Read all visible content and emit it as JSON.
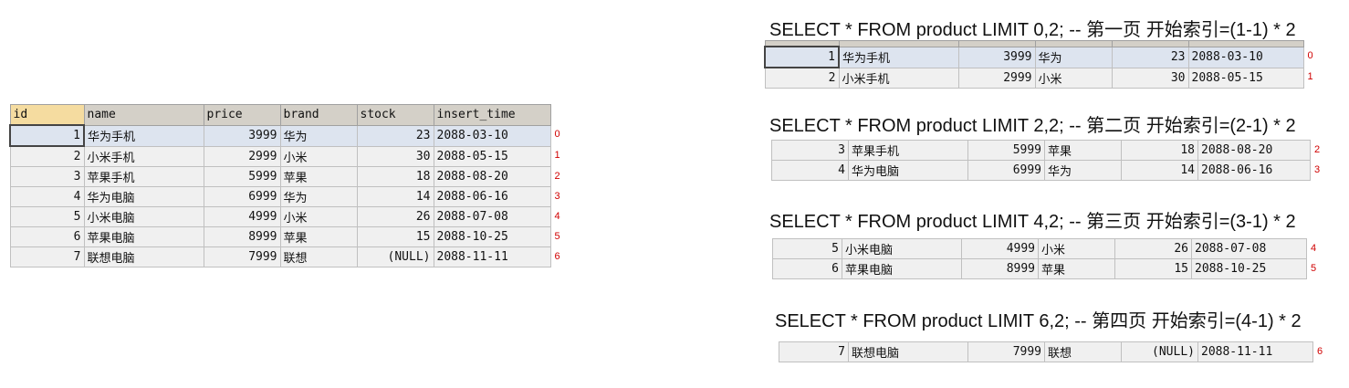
{
  "columns": [
    "id",
    "name",
    "price",
    "brand",
    "stock",
    "insert_time"
  ],
  "main_rows": [
    {
      "id": "1",
      "name": "华为手机",
      "price": "3999",
      "brand": "华为",
      "stock": "23",
      "insert_time": "2088-03-10",
      "idx": "0"
    },
    {
      "id": "2",
      "name": "小米手机",
      "price": "2999",
      "brand": "小米",
      "stock": "30",
      "insert_time": "2088-05-15",
      "idx": "1"
    },
    {
      "id": "3",
      "name": "苹果手机",
      "price": "5999",
      "brand": "苹果",
      "stock": "18",
      "insert_time": "2088-08-20",
      "idx": "2"
    },
    {
      "id": "4",
      "name": "华为电脑",
      "price": "6999",
      "brand": "华为",
      "stock": "14",
      "insert_time": "2088-06-16",
      "idx": "3"
    },
    {
      "id": "5",
      "name": "小米电脑",
      "price": "4999",
      "brand": "小米",
      "stock": "26",
      "insert_time": "2088-07-08",
      "idx": "4"
    },
    {
      "id": "6",
      "name": "苹果电脑",
      "price": "8999",
      "brand": "苹果",
      "stock": "15",
      "insert_time": "2088-10-25",
      "idx": "5"
    },
    {
      "id": "7",
      "name": "联想电脑",
      "price": "7999",
      "brand": "联想",
      "stock": "(NULL)",
      "insert_time": "2088-11-11",
      "idx": "6"
    }
  ],
  "pages": [
    {
      "sql": "SELECT * FROM product LIMIT 0,2;  -- 第一页 开始索引=(1-1) * 2",
      "rows": [
        {
          "id": "1",
          "name": "华为手机",
          "price": "3999",
          "brand": "华为",
          "stock": "23",
          "insert_time": "2088-03-10",
          "idx": "0"
        },
        {
          "id": "2",
          "name": "小米手机",
          "price": "2999",
          "brand": "小米",
          "stock": "30",
          "insert_time": "2088-05-15",
          "idx": "1"
        }
      ]
    },
    {
      "sql": "SELECT * FROM product LIMIT 2,2;  -- 第二页 开始索引=(2-1) * 2",
      "rows": [
        {
          "id": "3",
          "name": "苹果手机",
          "price": "5999",
          "brand": "苹果",
          "stock": "18",
          "insert_time": "2088-08-20",
          "idx": "2"
        },
        {
          "id": "4",
          "name": "华为电脑",
          "price": "6999",
          "brand": "华为",
          "stock": "14",
          "insert_time": "2088-06-16",
          "idx": "3"
        }
      ]
    },
    {
      "sql": "SELECT * FROM product LIMIT 4,2;  -- 第三页 开始索引=(3-1) * 2",
      "rows": [
        {
          "id": "5",
          "name": "小米电脑",
          "price": "4999",
          "brand": "小米",
          "stock": "26",
          "insert_time": "2088-07-08",
          "idx": "4"
        },
        {
          "id": "6",
          "name": "苹果电脑",
          "price": "8999",
          "brand": "苹果",
          "stock": "15",
          "insert_time": "2088-10-25",
          "idx": "5"
        }
      ]
    },
    {
      "sql": "SELECT * FROM product LIMIT 6,2;  -- 第四页 开始索引=(4-1) * 2",
      "rows": [
        {
          "id": "7",
          "name": "联想电脑",
          "price": "7999",
          "brand": "联想",
          "stock": "(NULL)",
          "insert_time": "2088-11-11",
          "idx": "6"
        }
      ]
    }
  ]
}
